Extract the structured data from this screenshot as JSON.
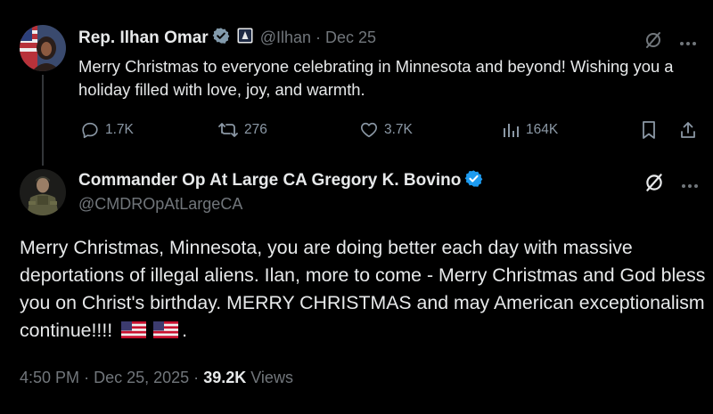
{
  "tweet1": {
    "author_name": "Rep. Ilhan Omar",
    "handle": "@Ilhan",
    "separator": "·",
    "date": "Dec 25",
    "text": "Merry Christmas to everyone celebrating in Minnesota and beyond! Wishing you a holiday filled with love, joy, and warmth.",
    "replies": "1.7K",
    "reposts": "276",
    "likes": "3.7K",
    "views": "164K"
  },
  "tweet2": {
    "author_name": "Commander Op At Large CA Gregory K. Bovino",
    "handle": "@CMDROpAtLargeCA",
    "text_before_flags": "Merry Christmas, Minnesota, you are doing better each day with massive deportations of illegal aliens.  Ilan, more to come - Merry Christmas and God bless you on Christ's birthday.  MERRY CHRISTMAS and may American exceptionalism continue!!!! ",
    "text_after_flags": ".",
    "time": "4:50 PM",
    "separator": "·",
    "full_date": "Dec 25, 2025",
    "views_count": "39.2K",
    "views_label": "Views"
  },
  "icons": {
    "verified": "verified-badge-icon",
    "gov": "government-label-icon",
    "grok": "grok-slash-icon",
    "more": "more-dots-icon",
    "reply": "reply-icon",
    "repost": "repost-icon",
    "like": "heart-icon",
    "views": "views-bars-icon",
    "bookmark": "bookmark-icon",
    "share": "share-icon",
    "flag": "us-flag-icon"
  },
  "colors": {
    "background": "#000000",
    "text": "#e7e9ea",
    "muted": "#71767b",
    "verified": "#1d9bf0"
  }
}
